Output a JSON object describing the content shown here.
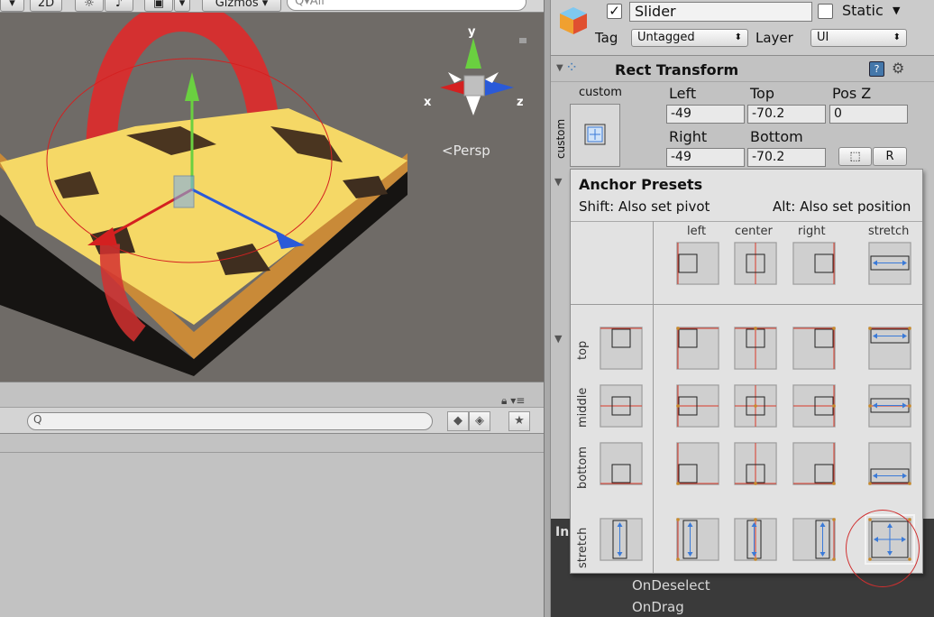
{
  "scene": {
    "toolbar": {
      "mode_2d": "2D",
      "gizmos": "Gizmos",
      "search_placeholder": "All"
    },
    "gizmo": {
      "axis_y": "y",
      "axis_x": "x",
      "axis_z": "z",
      "projection": "Persp"
    }
  },
  "lower_panel": {
    "search_placeholder": ""
  },
  "inspector": {
    "object_name": "Slider",
    "active": true,
    "static_label": "Static",
    "static": false,
    "tag_label": "Tag",
    "tag_value": "Untagged",
    "layer_label": "Layer",
    "layer_value": "UI",
    "rect_transform": {
      "title": "Rect Transform",
      "anchor_mode_top": "custom",
      "anchor_mode_side": "custom",
      "fields": {
        "left_label": "Left",
        "left": "-49",
        "top_label": "Top",
        "top": "-70.2",
        "posz_label": "Pos Z",
        "posz": "0",
        "right_label": "Right",
        "right": "-49",
        "bottom_label": "Bottom",
        "bottom": "-70.2"
      },
      "raw_button": "R"
    },
    "events": {
      "label": "In",
      "items": [
        "OnDeselect",
        "OnDrag"
      ]
    }
  },
  "anchor_presets": {
    "title": "Anchor Presets",
    "shift_hint": "Shift: Also set pivot",
    "alt_hint": "Alt: Also set position",
    "columns": [
      "left",
      "center",
      "right",
      "stretch"
    ],
    "rows": [
      "top",
      "middle",
      "bottom",
      "stretch"
    ],
    "selected": "stretch-stretch"
  },
  "colors": {
    "anchor_red": "#d93a2a",
    "stretch_blue": "#3a7ad8",
    "pivot_orange": "#c98a2a",
    "sand": "#f5d866",
    "gizmo_red": "#d42020",
    "gizmo_green": "#6ad040",
    "gizmo_blue": "#2a5ad8"
  }
}
